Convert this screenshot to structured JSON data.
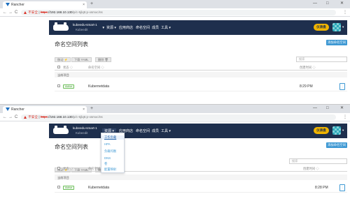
{
  "browser": {
    "tab_title": "Rancher",
    "new_tab": "+",
    "tab_close": "×",
    "window_controls": {
      "minimize": "—",
      "maximize": "□",
      "close": "✕"
    },
    "nav": {
      "back": "←",
      "forward": "→",
      "reload": "C",
      "menu": "⋮"
    },
    "security_label": "不安全",
    "url_scheme": "https",
    "url_host": "://192.168.10.130",
    "url_path": "/p/c-5jlq5:p-xsmxc/ns"
  },
  "topnav": {
    "cluster_name": "kubeedu-smart-1",
    "cluster_sub": "Kubeedit",
    "cluster_caret": "▼",
    "menu": [
      {
        "label": "资源 ▾"
      },
      {
        "label": "应用商店"
      },
      {
        "label": "命名空间"
      },
      {
        "label": "成员"
      },
      {
        "label": "工具 ▾"
      }
    ],
    "admin_label": "仪表盘",
    "avatar_caret": "▾"
  },
  "page": {
    "title": "命名空间列表",
    "add_button": "添加命名空间",
    "toolbar": {
      "edit": "移动 ⚡",
      "download": "下载 YAML",
      "delete": "删除 🗑"
    },
    "search_placeholder": "搜索",
    "columns": {
      "status": "状态 ◇",
      "name": "命名空间 ◇",
      "created": "创建时间 ◇"
    },
    "group_label": "当前项目",
    "rows": [
      {
        "status": "Active",
        "name": "Kubernetdata",
        "created": "8:29 PM",
        "menu": "⋮"
      }
    ]
  },
  "dropdown": {
    "items": [
      "工作负载",
      "HPA",
      "负载均衡",
      "DNS",
      "卷",
      "配置映射"
    ]
  },
  "second_shot": {
    "row_created": "8:28 PM"
  }
}
